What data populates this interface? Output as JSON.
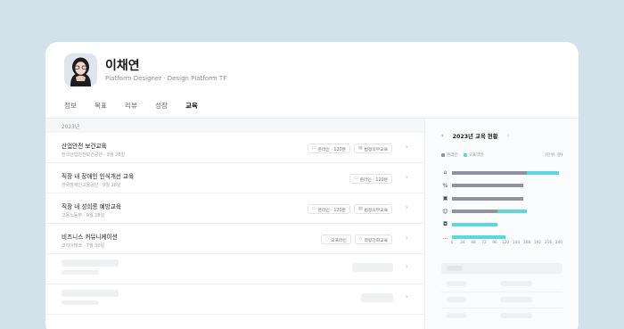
{
  "profile": {
    "name": "이채연",
    "role": "Platform Designer · Design Platform TF",
    "avatar_icon": "person-portrait-icon"
  },
  "tabs": [
    {
      "label": "정보",
      "active": false
    },
    {
      "label": "목표",
      "active": false
    },
    {
      "label": "리뷰",
      "active": false
    },
    {
      "label": "성장",
      "active": false
    },
    {
      "label": "교육",
      "active": true
    }
  ],
  "list": {
    "year": "2023년",
    "items": [
      {
        "title": "산업안전 보건교육",
        "sub": "한국산업안전보건공단 · 9월 28일",
        "tags": [
          {
            "icon": "monitor-icon",
            "label": "온라인 · 120분"
          },
          {
            "icon": "document-icon",
            "label": "법정의무교육"
          }
        ]
      },
      {
        "title": "직장 내 장애인 인식개선 교육",
        "sub": "한국장애인고용공단 · 9월 28일",
        "tags": [
          {
            "icon": "monitor-icon",
            "label": "온라인 · 120분"
          }
        ]
      },
      {
        "title": "직장 내 성희롱 예방교육",
        "sub": "고용노동부 · 9월 28일",
        "tags": [
          {
            "icon": "monitor-icon",
            "label": "온라인 · 120분"
          },
          {
            "icon": "document-icon",
            "label": "법정의무교육"
          }
        ]
      },
      {
        "title": "비즈니스 커뮤니케이션",
        "sub": "코리아테크 · 7월 30일",
        "tags": [
          {
            "icon": "people-icon",
            "label": "오프라인"
          },
          {
            "icon": "tag-icon",
            "label": "역량강화교육"
          }
        ]
      }
    ]
  },
  "sidebar": {
    "title": "2023년 교육 현황",
    "prev_icon": "chevron-left-icon",
    "next_icon": "chevron-right-icon",
    "legend": [
      {
        "label": "온라인",
        "color": "#8e939c"
      },
      {
        "label": "오프라인",
        "color": "#5dd6de"
      }
    ],
    "unit": "(단위: 분)"
  },
  "chart_data": {
    "type": "bar",
    "orientation": "horizontal",
    "stacked": true,
    "categories": [
      "bank-icon",
      "percent-icon",
      "briefcase-icon",
      "people-icon",
      "chat-icon",
      "more-icon"
    ],
    "series": [
      {
        "name": "온라인",
        "color": "#8e939c",
        "values": [
          168,
          160,
          160,
          102,
          0,
          0
        ]
      },
      {
        "name": "오프라인",
        "color": "#5dd6de",
        "values": [
          72,
          0,
          0,
          66,
          102,
          120
        ]
      }
    ],
    "x_ticks": [
      "0",
      "24",
      "48",
      "72",
      "96",
      "120",
      "144",
      "168",
      "192",
      "216",
      "240"
    ],
    "xlim": [
      0,
      240
    ]
  }
}
